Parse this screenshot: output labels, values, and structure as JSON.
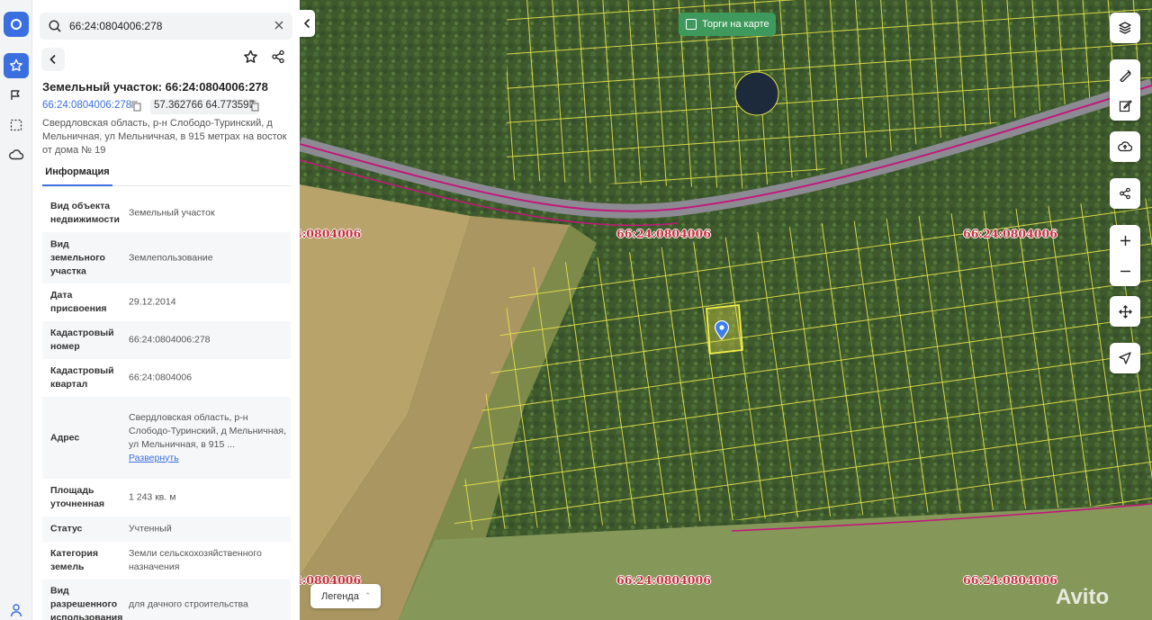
{
  "search": {
    "query": "66:24:0804006:278"
  },
  "object": {
    "title": "Земельный участок: 66:24:0804006:278",
    "cadastral_link": "66:24:0804006:278",
    "coordinates": "57.362766 64.773597",
    "address": "Свердловская область, р-н Слободо-Туринский, д Мельничная, ул Мельничная, в 915 метрах на восток от дома № 19"
  },
  "tabs": [
    {
      "label": "Информация",
      "active": true
    }
  ],
  "properties": [
    {
      "key": "Вид объекта недвижимости",
      "value": "Земельный участок"
    },
    {
      "key": "Вид земельного участка",
      "value": "Землепользование"
    },
    {
      "key": "Дата присвоения",
      "value": "29.12.2014"
    },
    {
      "key": "Кадастровый номер",
      "value": "66:24:0804006:278"
    },
    {
      "key": "Кадастровый квартал",
      "value": "66:24:0804006"
    },
    {
      "key": "Адрес",
      "value": "Свердловская область, р-н Слободо-Туринский, д Мельничная, ул Мельничная, в 915 ...",
      "link": "Развернуть"
    },
    {
      "key": "Площадь уточненная",
      "value": "1 243 кв. м"
    },
    {
      "key": "Статус",
      "value": "Учтенный"
    },
    {
      "key": "Категория земель",
      "value": "Земли сельскохозяйственного назначения"
    },
    {
      "key": "Вид разрешенного использования",
      "value": "для дачного строительства"
    }
  ],
  "map": {
    "torgi_label": "Торги на карте",
    "legend_label": "Легенда",
    "quarter_label": "66:24:0804006",
    "quarter_label_cut": "4:0804006",
    "watermark": "Avito"
  },
  "icons": {
    "rail": [
      "logo-icon",
      "star-icon",
      "route-icon",
      "select-area-icon",
      "cloud-icon",
      "user-icon"
    ],
    "tools": [
      "layers-icon",
      "ruler-icon",
      "edit-icon",
      "upload-icon",
      "share-icon",
      "zoom-in-icon",
      "zoom-out-icon",
      "move-icon",
      "locate-icon"
    ]
  },
  "colors": {
    "accent": "#3b6fe0",
    "torgi_green": "#3d9a5c",
    "quarter_red": "#c4313f",
    "parcel_yellow": "#e8e24a",
    "road_magenta": "#c2187a"
  }
}
